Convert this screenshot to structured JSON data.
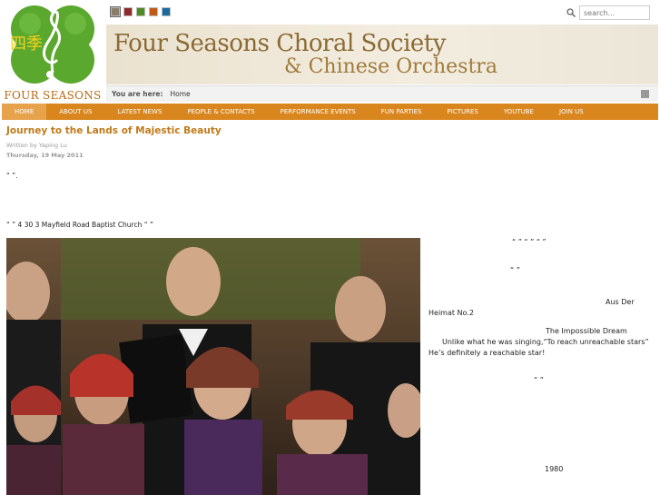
{
  "site": {
    "logo_caption": "FOUR SEASONS",
    "logo_chars": "四季",
    "title_line1": "Four Seasons Choral Society",
    "title_line2": "& Chinese Orchestra"
  },
  "theme_swatches": [
    "#8a7d6a",
    "#8e2a2a",
    "#4e8a22",
    "#c05a1a",
    "#1a6aa0"
  ],
  "search": {
    "placeholder": "search..."
  },
  "breadcrumb": {
    "label": "You are here:",
    "current": "Home"
  },
  "nav": [
    "Home",
    "About Us",
    "Latest News",
    "People & Contacts",
    "Performance Events",
    "Fun Parties",
    "Pictures",
    "YouTube",
    "Join Us"
  ],
  "article": {
    "title": "Journey to the Lands of Majestic Beauty",
    "author": "Written by Yaping Lu",
    "date": "Thursday, 19 May 2011",
    "para1": "“          ”.",
    "para2": "“     ”                    4 30      3     Mayfield Road Baptist Church                         “                                    ”"
  },
  "sidebar_text": {
    "t1": "“  ”  “  ”    “  ”",
    "t2": "“                      ”",
    "t3": "Aus Der",
    "t4": "Heimat No.2",
    "t5": "The Impossible Dream",
    "t6": "Unlike what he was singing,“To reach unreachable stars”",
    "t7": "He’s definitely a reachable star!",
    "t8": "“           ”",
    "t9": "1980"
  },
  "colors": {
    "nav": "#d9861e",
    "title": "#c07a1a",
    "banner_text": "#8c6a34"
  }
}
